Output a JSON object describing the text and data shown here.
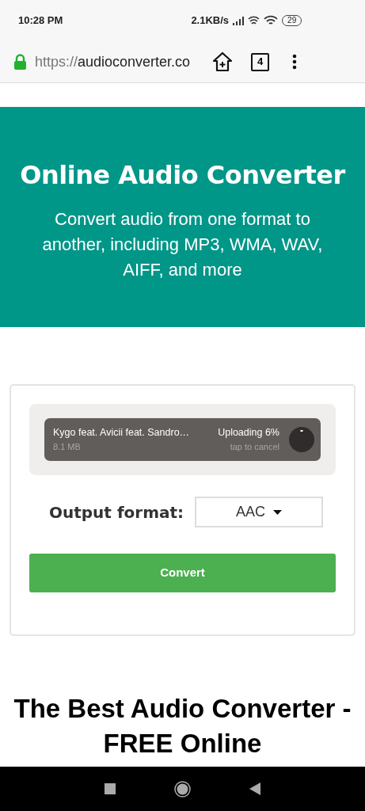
{
  "status_bar": {
    "time": "10:28 PM",
    "speed": "2.1KB/s",
    "battery": "29"
  },
  "browser": {
    "url_scheme": "https://",
    "url_host": "audioconverter.co",
    "tab_count": "4"
  },
  "hero": {
    "title": "Online Audio Converter",
    "subtitle": "Convert audio from one format to another, including MP3, WMA, WAV, AIFF, and more"
  },
  "upload": {
    "file_name": "Kygo feat. Avicii feat. Sandro…",
    "file_size": "8.1 MB",
    "status": "Uploading 6%",
    "hint": "tap to cancel"
  },
  "output_format": {
    "label": "Output format:",
    "value": "AAC"
  },
  "convert_button": "Convert",
  "section_heading": "The Best Audio Converter - FREE Online"
}
